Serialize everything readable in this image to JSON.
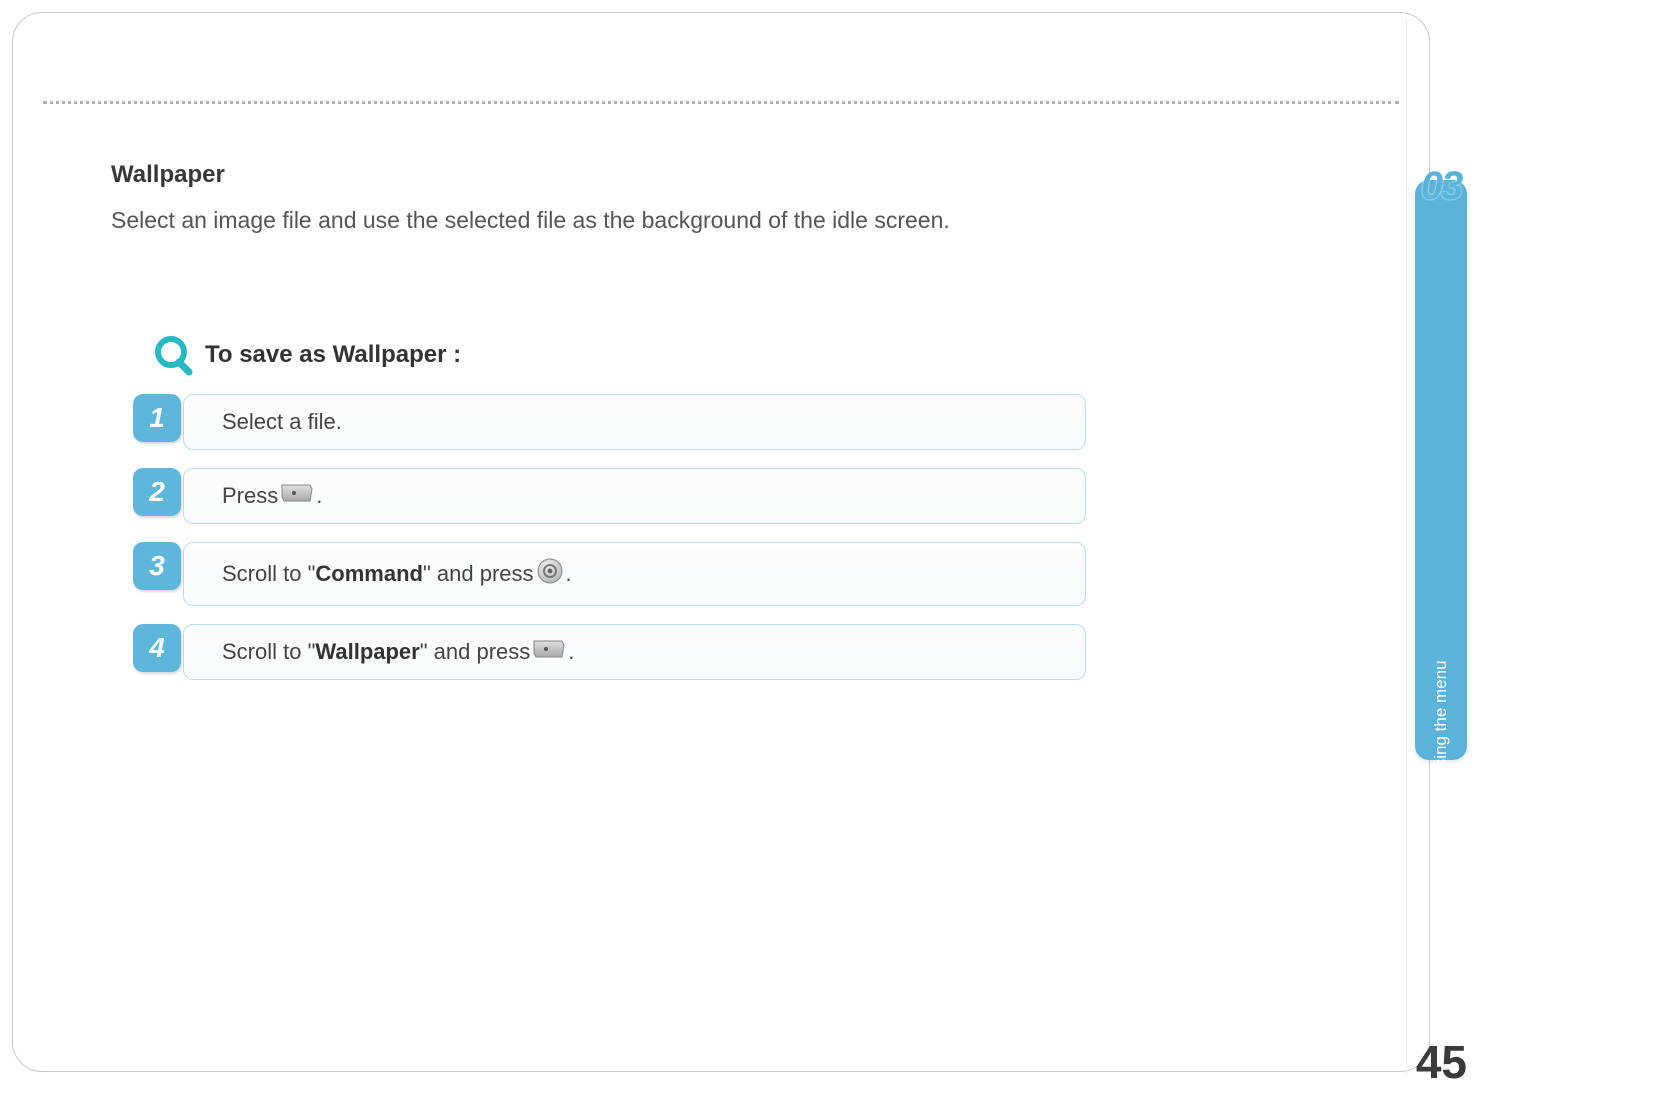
{
  "section": {
    "title": "Wallpaper",
    "description": "Select an image file and use the selected file as the background of the idle screen."
  },
  "procedure": {
    "title": "To save as Wallpaper :",
    "steps": [
      {
        "num": "1",
        "parts": [
          {
            "t": "text",
            "v": "Select a file."
          }
        ]
      },
      {
        "num": "2",
        "parts": [
          {
            "t": "text",
            "v": "Press "
          },
          {
            "t": "icon",
            "v": "softkey"
          },
          {
            "t": "text",
            "v": "."
          }
        ]
      },
      {
        "num": "3",
        "parts": [
          {
            "t": "text",
            "v": "Scroll to \""
          },
          {
            "t": "bold",
            "v": "Command"
          },
          {
            "t": "text",
            "v": "\" and press "
          },
          {
            "t": "icon",
            "v": "ok"
          },
          {
            "t": "text",
            "v": "."
          }
        ]
      },
      {
        "num": "4",
        "parts": [
          {
            "t": "text",
            "v": "Scroll to \""
          },
          {
            "t": "bold",
            "v": "Wallpaper"
          },
          {
            "t": "text",
            "v": "\" and press "
          },
          {
            "t": "icon",
            "v": "softkey"
          },
          {
            "t": "text",
            "v": "."
          }
        ]
      }
    ]
  },
  "chapter": {
    "num": "03",
    "label": "Using the menu"
  },
  "page_number": "45"
}
